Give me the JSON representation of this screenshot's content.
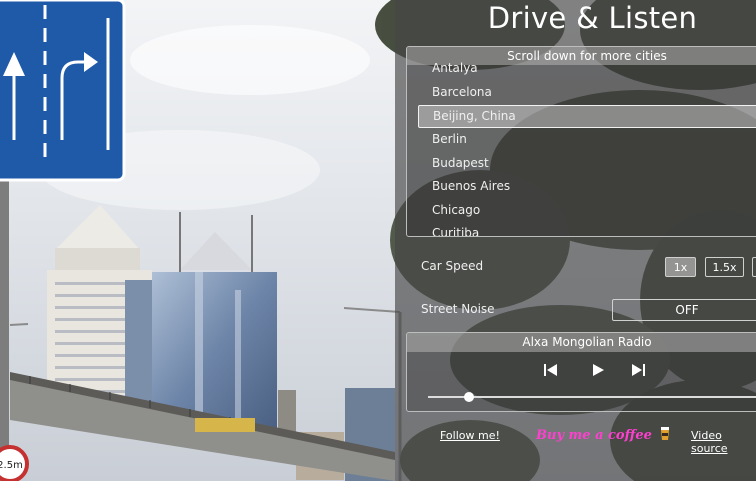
{
  "app": {
    "title": "Drive & Listen"
  },
  "cities": {
    "hint": "Scroll down for more cities",
    "items": [
      "Antalya",
      "Barcelona",
      "Beijing, China",
      "Berlin",
      "Budapest",
      "Buenos Aires",
      "Chicago",
      "Curitiba"
    ],
    "selected": "Beijing, China"
  },
  "car_speed": {
    "label": "Car Speed",
    "options": [
      "1x",
      "1.5x"
    ],
    "selected": "1x"
  },
  "street_noise": {
    "label": "Street Noise",
    "value": "OFF"
  },
  "radio": {
    "station": "Alxa Mongolian Radio",
    "volume": 0.12
  },
  "footer": {
    "follow": "Follow me!",
    "coffee": "Buy me a coffee",
    "video_source": "Video source"
  },
  "background": {
    "sign_text": "2.5m"
  },
  "colors": {
    "panel": "#464646",
    "coffee": "#ff3fd0",
    "sign_blue": "#1f5aa8"
  }
}
